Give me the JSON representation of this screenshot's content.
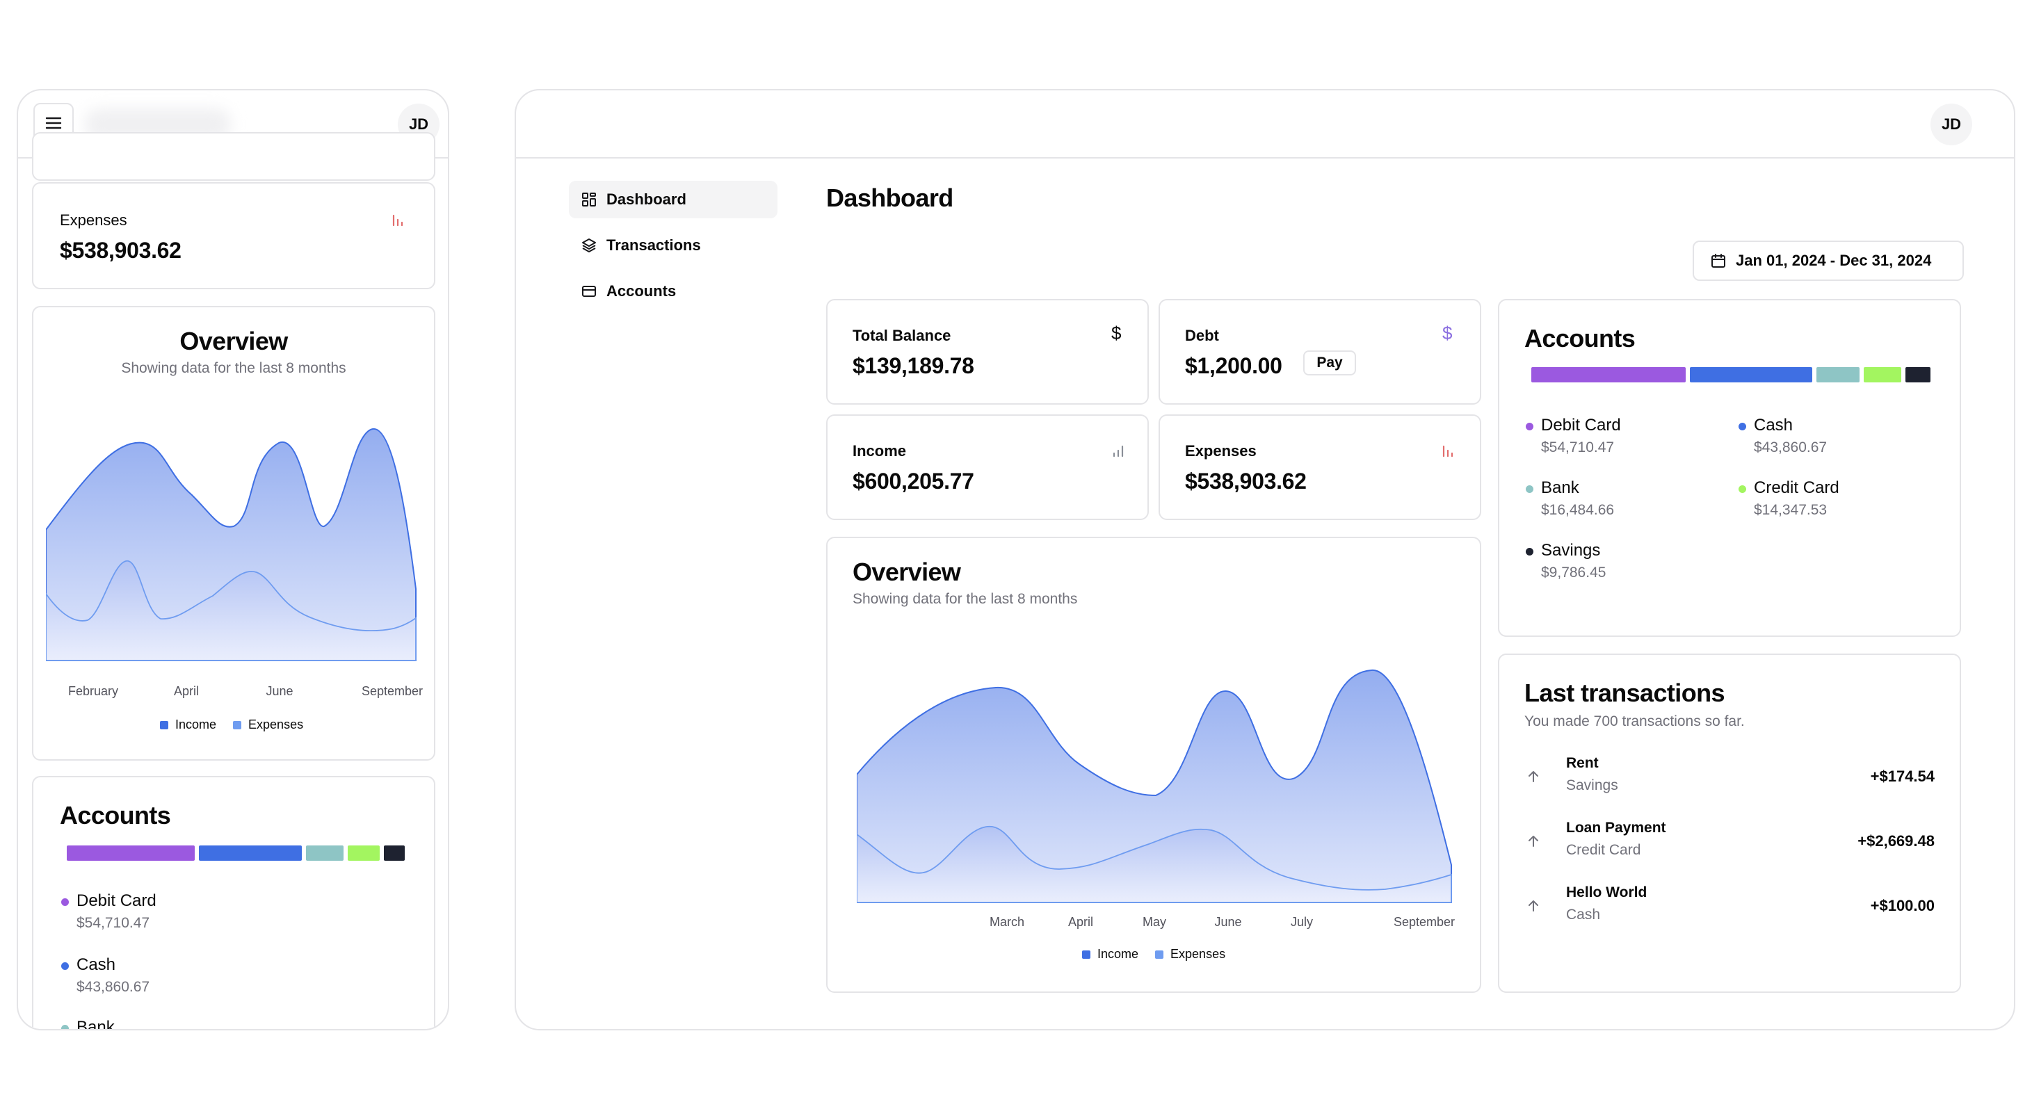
{
  "mobile": {
    "avatar": "JD",
    "expenses_card": {
      "label": "Expenses",
      "value": "$538,903.62"
    },
    "overview": {
      "title": "Overview",
      "subtitle": "Showing data for the last 8 months",
      "x_ticks": [
        "February",
        "April",
        "June",
        "September"
      ],
      "legend": [
        "Income",
        "Expenses"
      ]
    },
    "accounts": {
      "title": "Accounts",
      "items": [
        {
          "name": "Debit Card",
          "value": "$54,710.47",
          "color": "#9b59e0"
        },
        {
          "name": "Cash",
          "value": "$43,860.67",
          "color": "#3f6fe3"
        },
        {
          "name": "Bank",
          "value": "",
          "color": "#8ec5c5"
        }
      ]
    }
  },
  "desktop": {
    "avatar": "JD",
    "sidebar": {
      "items": [
        {
          "label": "Dashboard",
          "icon": "grid-icon",
          "active": true
        },
        {
          "label": "Transactions",
          "icon": "layers-icon",
          "active": false
        },
        {
          "label": "Accounts",
          "icon": "card-icon",
          "active": false
        }
      ]
    },
    "page_title": "Dashboard",
    "date_range": "Jan 01, 2024 - Dec 31, 2024",
    "stats": {
      "total_balance": {
        "label": "Total Balance",
        "value": "$139,189.78",
        "icon": "dollar-icon"
      },
      "debt": {
        "label": "Debt",
        "value": "$1,200.00",
        "icon": "dollar-icon",
        "action": "Pay"
      },
      "income": {
        "label": "Income",
        "value": "$600,205.77",
        "icon": "bar-chart-icon"
      },
      "expenses": {
        "label": "Expenses",
        "value": "$538,903.62",
        "icon": "bar-chart-icon"
      }
    },
    "overview": {
      "title": "Overview",
      "subtitle": "Showing data for the last 8 months",
      "x_ticks": [
        "March",
        "April",
        "May",
        "June",
        "July",
        "September"
      ],
      "legend": [
        "Income",
        "Expenses"
      ]
    },
    "accounts": {
      "title": "Accounts",
      "items": [
        {
          "name": "Debit Card",
          "value": "$54,710.47",
          "color": "#9b59e0"
        },
        {
          "name": "Cash",
          "value": "$43,860.67",
          "color": "#3f6fe3"
        },
        {
          "name": "Bank",
          "value": "$16,484.66",
          "color": "#8ec5c5"
        },
        {
          "name": "Credit Card",
          "value": "$14,347.53",
          "color": "#a3f560"
        },
        {
          "name": "Savings",
          "value": "$9,786.45",
          "color": "#1e2230"
        }
      ]
    },
    "transactions": {
      "title": "Last transactions",
      "subtitle": "You made 700 transactions so far.",
      "items": [
        {
          "name": "Rent",
          "account": "Savings",
          "amount": "+$174.54"
        },
        {
          "name": "Loan Payment",
          "account": "Credit Card",
          "amount": "+$2,669.48"
        },
        {
          "name": "Hello World",
          "account": "Cash",
          "amount": "+$100.00"
        }
      ]
    }
  },
  "colors": {
    "income": "#3f6fe3",
    "expenses": "#6f9cf0",
    "income_fill_top": "#8ea9ef",
    "border": "#e4e4e7",
    "muted_text": "#71717a"
  }
}
